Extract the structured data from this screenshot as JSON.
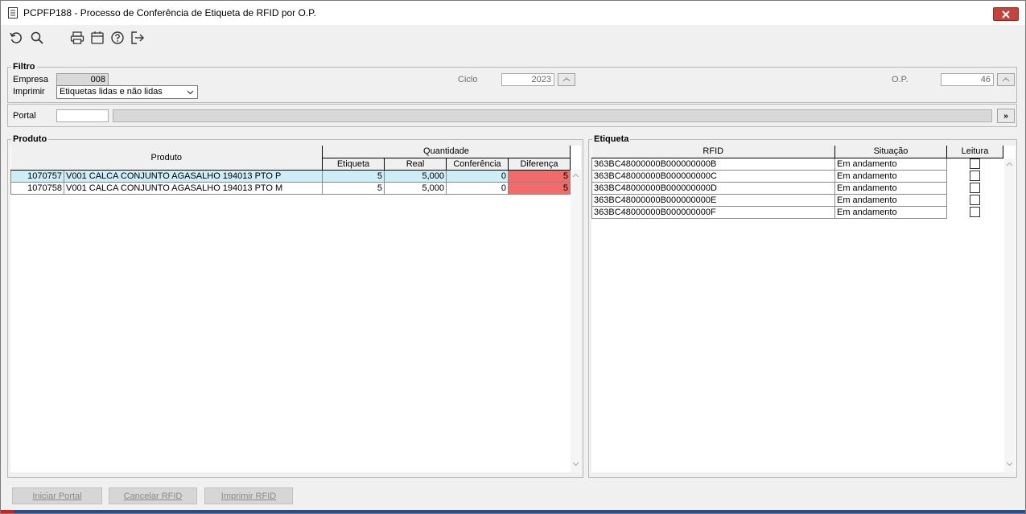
{
  "window": {
    "title": "PCPFP188 - Processo de Conferência de Etiqueta de RFID por O.P."
  },
  "toolbar": {
    "icons": [
      "refresh-icon",
      "search-icon",
      "print-icon",
      "calendar-icon",
      "help-icon",
      "exit-icon"
    ]
  },
  "filter": {
    "group_label": "Filtro",
    "empresa_label": "Empresa",
    "empresa_value": "008",
    "imprimir_label": "Imprimir",
    "imprimir_value": "Etiquetas lidas e não lidas",
    "ciclo_label": "Ciclo",
    "ciclo_value": "2023",
    "op_label": "O.P.",
    "op_value": "46"
  },
  "portal": {
    "label": "Portal",
    "value": "",
    "button_label": "»"
  },
  "produto": {
    "group_label": "Produto",
    "headers": {
      "produto": "Produto",
      "quantidade": "Quantidade",
      "etiqueta": "Etiqueta",
      "real": "Real",
      "conferencia": "Conferência",
      "diferenca": "Diferença"
    },
    "rows": [
      {
        "code": "1070757",
        "desc": "V001 CALCA CONJUNTO AGASALHO 194013 PTO P",
        "etiqueta": "5",
        "real": "5,000",
        "conferencia": "0",
        "diferenca": "5"
      },
      {
        "code": "1070758",
        "desc": "V001 CALCA CONJUNTO AGASALHO 194013 PTO M",
        "etiqueta": "5",
        "real": "5,000",
        "conferencia": "0",
        "diferenca": "5"
      }
    ]
  },
  "etiqueta": {
    "group_label": "Etiqueta",
    "headers": {
      "rfid": "RFID",
      "situacao": "Situação",
      "leitura": "Leitura"
    },
    "rows": [
      {
        "rfid": "363BC48000000B000000000B",
        "situacao": "Em andamento"
      },
      {
        "rfid": "363BC48000000B000000000C",
        "situacao": "Em andamento"
      },
      {
        "rfid": "363BC48000000B000000000D",
        "situacao": "Em andamento"
      },
      {
        "rfid": "363BC48000000B000000000E",
        "situacao": "Em andamento"
      },
      {
        "rfid": "363BC48000000B000000000F",
        "situacao": "Em andamento"
      }
    ]
  },
  "buttons": {
    "iniciar_portal": "Iniciar Portal",
    "cancelar_rfid": "Cancelar RFID",
    "imprimir_rfid": "Imprimir RFID"
  },
  "colors": {
    "selected_row": "#cdeef7",
    "difference_cell": "#f26b6b",
    "close_button": "#c7423a"
  }
}
